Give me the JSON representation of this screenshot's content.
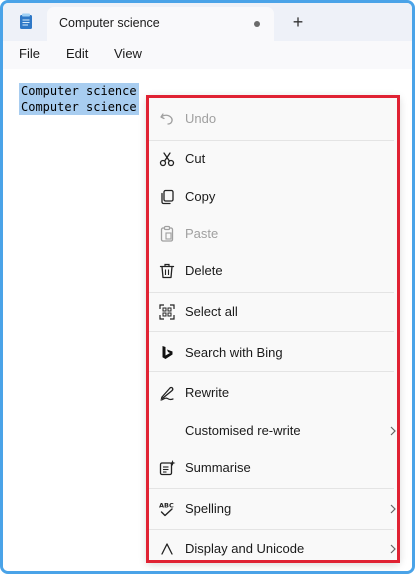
{
  "tab": {
    "title": "Computer science",
    "new_tab_symbol": "+"
  },
  "menubar": {
    "file": "File",
    "edit": "Edit",
    "view": "View"
  },
  "editor": {
    "lines": [
      "Computer science",
      "Computer science"
    ]
  },
  "context_menu": {
    "undo": "Undo",
    "cut": "Cut",
    "copy": "Copy",
    "paste": "Paste",
    "delete": "Delete",
    "select_all": "Select all",
    "search_bing": "Search with Bing",
    "rewrite": "Rewrite",
    "customised_rewrite": "Customised re-write",
    "summarise": "Summarise",
    "spelling": "Spelling",
    "display_unicode": "Display and Unicode"
  },
  "colors": {
    "frame_border": "#4aa3e8",
    "highlight_border": "#e02233",
    "selection": "#a8cdf0"
  }
}
